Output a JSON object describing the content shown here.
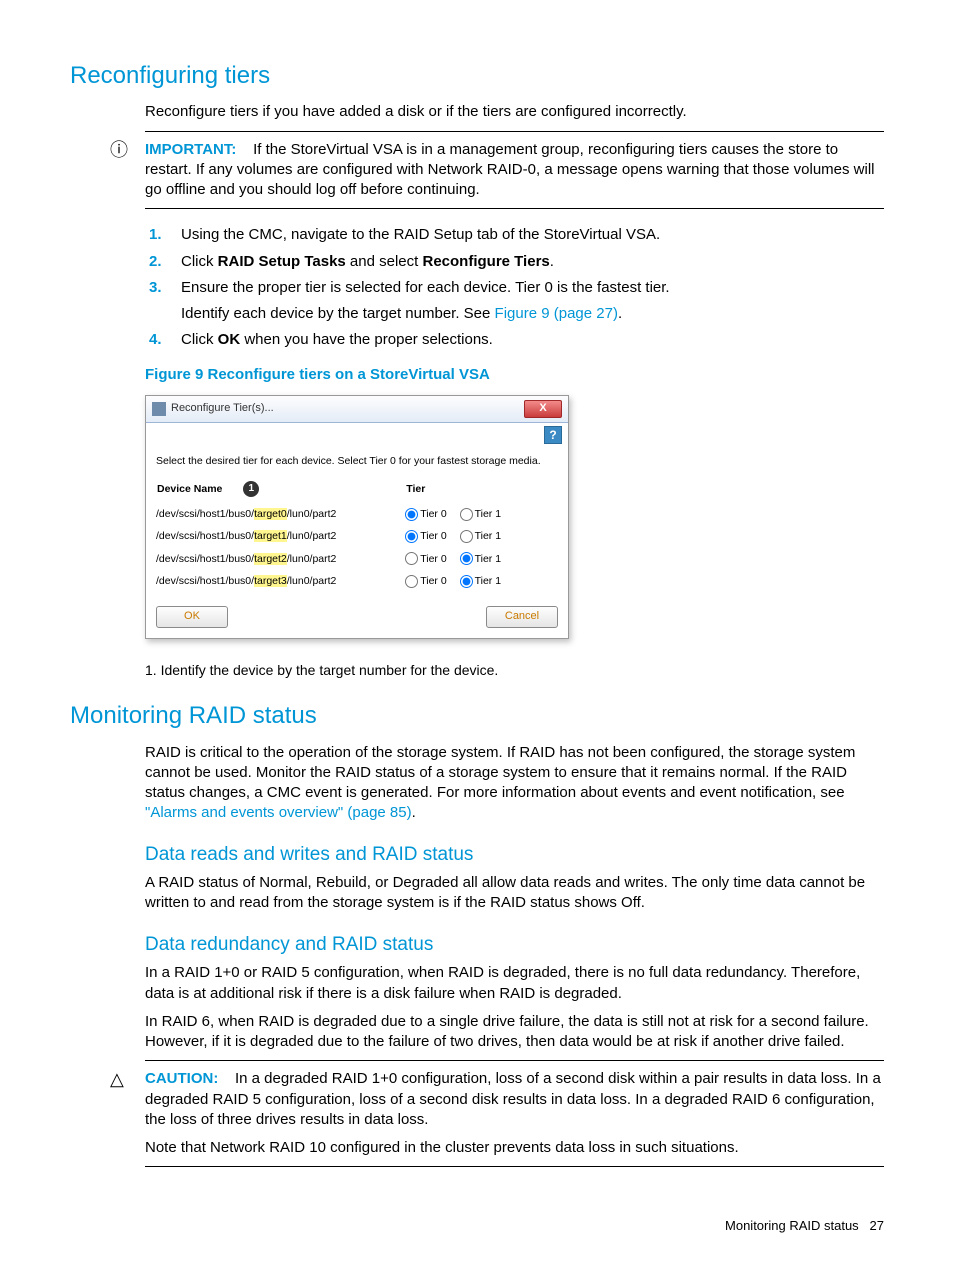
{
  "sections": {
    "reconf_title": "Reconfiguring tiers",
    "reconf_intro": "Reconfigure tiers if you have added a disk or if the tiers are configured incorrectly.",
    "important_label": "IMPORTANT:",
    "important_text": "If the StoreVirtual VSA is in a management group, reconfiguring tiers causes the store to restart. If any volumes are configured with Network RAID-0, a message opens warning that those volumes will go offline and you should log off before continuing.",
    "steps": {
      "s1": "Using the CMC, navigate to the RAID Setup tab of the StoreVirtual VSA.",
      "s2a": "Click ",
      "s2b": "RAID Setup Tasks",
      "s2c": " and select ",
      "s2d": "Reconfigure Tiers",
      "s2e": ".",
      "s3a": "Ensure the proper tier is selected for each device. Tier 0 is the fastest tier.",
      "s3b": "Identify each device by the target number. See ",
      "s3link": "Figure 9 (page 27)",
      "s3c": ".",
      "s4a": "Click ",
      "s4b": "OK",
      "s4c": " when you have the proper selections."
    },
    "fig_caption": "Figure 9 Reconfigure tiers on a StoreVirtual VSA",
    "footnote": "1. Identify the device by the target number for the device.",
    "monitoring_title": "Monitoring RAID status",
    "monitoring_p1": "RAID is critical to the operation of the storage system. If RAID has not been configured, the storage system cannot be used. Monitor the RAID status of a storage system to ensure that it remains normal. If the RAID status changes, a CMC event is generated. For more information about events and event notification, see ",
    "monitoring_link": "\"Alarms and events overview\" (page 85)",
    "monitoring_p1end": ".",
    "datarw_title": "Data reads and writes and RAID status",
    "datarw_p": "A RAID status of Normal, Rebuild, or Degraded all allow data reads and writes. The only time data cannot be written to and read from the storage system is if the RAID status shows Off.",
    "datared_title": "Data redundancy and RAID status",
    "datared_p1": "In a RAID 1+0 or RAID 5 configuration, when RAID is degraded, there is no full data redundancy. Therefore, data is at additional risk if there is a disk failure when RAID is degraded.",
    "datared_p2": "In RAID 6, when RAID is degraded due to a single drive failure, the data is still not at risk for a second failure. However, if it is degraded due to the failure of two drives, then data would be at risk if another drive failed.",
    "caution_label": "CAUTION:",
    "caution_text": "In a degraded RAID 1+0 configuration, loss of a second disk within a pair results in data loss. In a degraded RAID 5 configuration, loss of a second disk results in data loss. In a degraded RAID 6 configuration, the loss of three drives results in data loss.",
    "caution_note": "Note that Network RAID 10 configured in the cluster prevents data loss in such situations."
  },
  "dialog": {
    "title": "Reconfigure Tier(s)...",
    "help": "?",
    "close": "X",
    "instruction": "Select the desired tier for each device. Select Tier 0 for your fastest storage media.",
    "col_device": "Device Name",
    "col_tier": "Tier",
    "badge": "1",
    "tier0": "Tier 0",
    "tier1": "Tier 1",
    "ok": "OK",
    "cancel": "Cancel",
    "rows": [
      {
        "pre": "/dev/scsi/host1/bus0/",
        "hl": "target0",
        "post": "/lun0/part2",
        "sel": 0
      },
      {
        "pre": "/dev/scsi/host1/bus0/",
        "hl": "target1",
        "post": "/lun0/part2",
        "sel": 0
      },
      {
        "pre": "/dev/scsi/host1/bus0/",
        "hl": "target2",
        "post": "/lun0/part2",
        "sel": 1
      },
      {
        "pre": "/dev/scsi/host1/bus0/",
        "hl": "target3",
        "post": "/lun0/part2",
        "sel": 1
      }
    ]
  },
  "footer": {
    "section": "Monitoring RAID status",
    "page": "27"
  }
}
